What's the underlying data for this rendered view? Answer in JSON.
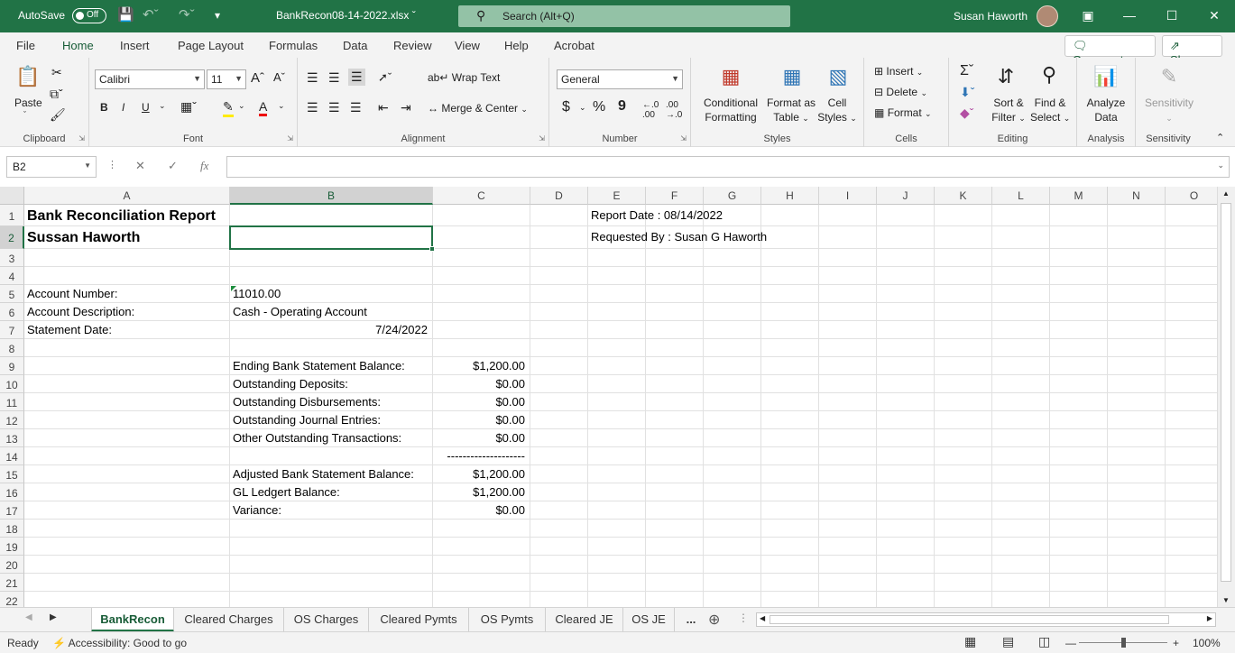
{
  "titlebar": {
    "autosave_label": "AutoSave",
    "autosave_state": "Off",
    "file_name": "BankRecon08-14-2022.xlsx",
    "search_placeholder": "Search (Alt+Q)",
    "user_name": "Susan Haworth"
  },
  "menu": {
    "tabs": [
      "File",
      "Home",
      "Insert",
      "Page Layout",
      "Formulas",
      "Data",
      "Review",
      "View",
      "Help",
      "Acrobat"
    ],
    "active_tab": "Home",
    "comments_label": "Comments",
    "share_label": "Share"
  },
  "ribbon": {
    "clipboard": {
      "paste": "Paste",
      "label": "Clipboard"
    },
    "font": {
      "name": "Calibri",
      "size": "11",
      "bold": "B",
      "italic": "I",
      "underline": "U",
      "label": "Font"
    },
    "alignment": {
      "wrap_text": "Wrap Text",
      "merge_center": "Merge & Center",
      "label": "Alignment"
    },
    "number": {
      "format": "General",
      "currency": "$",
      "percent": "%",
      "comma": "9",
      "label": "Number"
    },
    "styles": {
      "conditional_1": "Conditional",
      "conditional_2": "Formatting",
      "format_table_1": "Format as",
      "format_table_2": "Table",
      "cell_styles_1": "Cell",
      "cell_styles_2": "Styles",
      "label": "Styles"
    },
    "cells": {
      "insert": "Insert",
      "delete": "Delete",
      "format": "Format",
      "label": "Cells"
    },
    "editing": {
      "sort_1": "Sort &",
      "sort_2": "Filter",
      "find_1": "Find &",
      "find_2": "Select",
      "label": "Editing"
    },
    "analysis": {
      "analyze_1": "Analyze",
      "analyze_2": "Data",
      "label": "Analysis"
    },
    "sensitivity": {
      "button": "Sensitivity",
      "label": "Sensitivity"
    }
  },
  "formula_bar": {
    "name_box": "B2",
    "formula": ""
  },
  "columns": [
    "A",
    "B",
    "C",
    "D",
    "E",
    "F",
    "G",
    "H",
    "I",
    "J",
    "K",
    "L",
    "M",
    "N",
    "O"
  ],
  "selected_column": "B",
  "selected_row": 2,
  "rows": [
    "1",
    "2",
    "3",
    "4",
    "5",
    "6",
    "7",
    "8",
    "9",
    "10",
    "11",
    "12",
    "13",
    "14",
    "15",
    "16",
    "17",
    "18",
    "19",
    "20",
    "21",
    "22"
  ],
  "cells": {
    "A1": "Bank Reconciliation Report",
    "A2": "Sussan Haworth",
    "E1": "Report Date : 08/14/2022",
    "E2": "Requested By : Susan G Haworth",
    "A5": "Account Number:",
    "B5": "11010.00",
    "A6": "Account Description:",
    "B6": "Cash - Operating Account",
    "A7": "Statement Date:",
    "B7": "7/24/2022",
    "B9": "Ending Bank Statement Balance:",
    "C9": "$1,200.00",
    "B10": "Outstanding Deposits:",
    "C10": "$0.00",
    "B11": "Outstanding Disbursements:",
    "C11": "$0.00",
    "B12": "Outstanding Journal Entries:",
    "C12": "$0.00",
    "B13": "Other Outstanding Transactions:",
    "C13": "$0.00",
    "C14": "--------------------",
    "B15": "Adjusted Bank Statement Balance:",
    "C15": "$1,200.00",
    "B16": "GL Ledgert Balance:",
    "C16": "$1,200.00",
    "B17": "Variance:",
    "C17": "$0.00"
  },
  "sheets": [
    "BankRecon",
    "Cleared Charges",
    "OS Charges",
    "Cleared Pymts",
    "OS Pymts",
    "Cleared JE",
    "OS JE",
    "..."
  ],
  "active_sheet": "BankRecon",
  "status": {
    "ready": "Ready",
    "accessibility": "Accessibility: Good to go",
    "zoom": "100%"
  }
}
